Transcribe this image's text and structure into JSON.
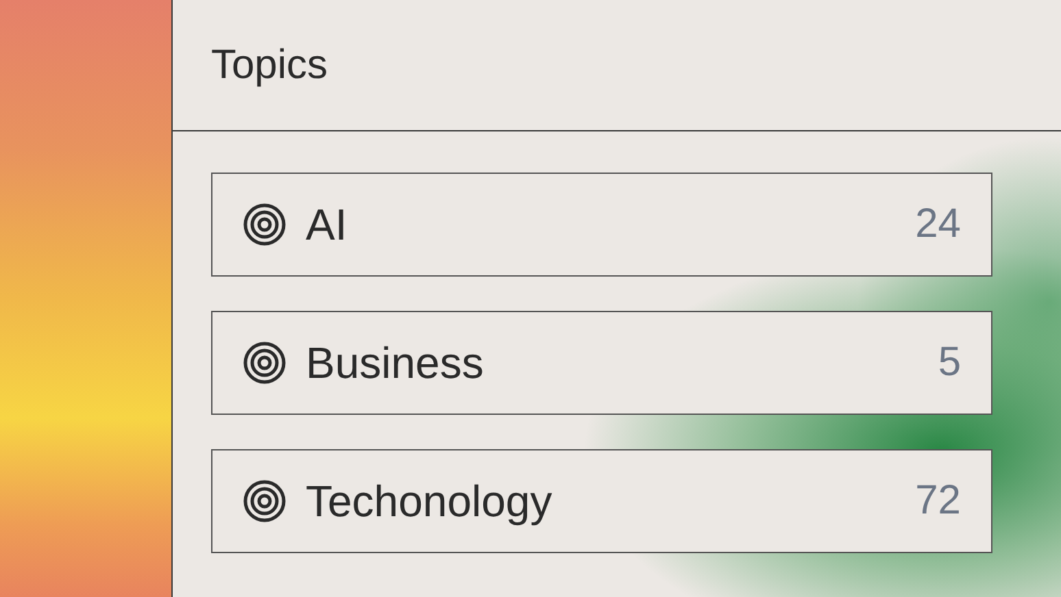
{
  "header": {
    "title": "Topics"
  },
  "topics": [
    {
      "label": "AI",
      "count": "24"
    },
    {
      "label": "Business",
      "count": "5"
    },
    {
      "label": "Techonology",
      "count": "72"
    }
  ]
}
